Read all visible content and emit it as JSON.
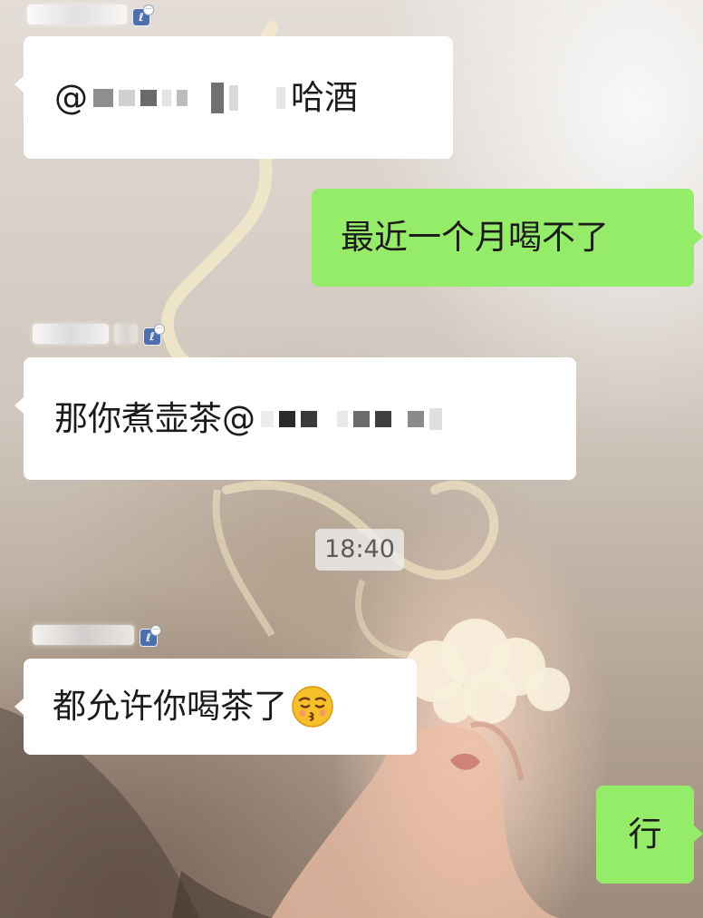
{
  "chat": {
    "time_label": "18:40",
    "messages": [
      {
        "side": "left",
        "prefix": "@",
        "suffix": "哈酒"
      },
      {
        "side": "right",
        "text": "最近一个月喝不了"
      },
      {
        "side": "left",
        "text": "那你煮壶茶@"
      },
      {
        "side": "left",
        "text": "都允许你喝茶了",
        "emoji": "kissing-face-emoji"
      },
      {
        "side": "right",
        "text": "行"
      }
    ]
  },
  "colors": {
    "outgoing_bubble": "#95ec69",
    "incoming_bubble": "#ffffff",
    "badge": "#4e6fae"
  },
  "icons": {
    "member_badge": "member-badge-icon",
    "blurred_name": "mosaic-redaction"
  }
}
